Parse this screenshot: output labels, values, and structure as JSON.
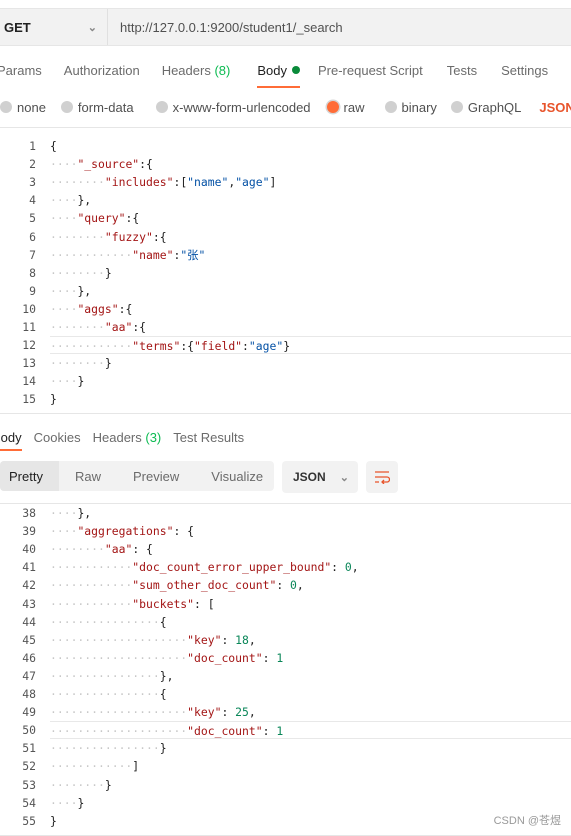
{
  "request": {
    "method": "GET",
    "url": "http://127.0.0.1:9200/student1/_search"
  },
  "tabs": [
    {
      "label": "Params"
    },
    {
      "label": "Authorization"
    },
    {
      "label": "Headers",
      "count": "(8)"
    },
    {
      "label": "Body"
    },
    {
      "label": "Pre-request Script"
    },
    {
      "label": "Tests"
    },
    {
      "label": "Settings"
    }
  ],
  "body_types": [
    {
      "label": "none",
      "selected": false
    },
    {
      "label": "form-data",
      "selected": false
    },
    {
      "label": "x-www-form-urlencoded",
      "selected": false
    },
    {
      "label": "raw",
      "selected": true
    },
    {
      "label": "binary",
      "selected": false
    },
    {
      "label": "GraphQL",
      "selected": false
    }
  ],
  "body_format": "JSON",
  "request_body": {
    "start": 1,
    "cursor_line": 12,
    "lines": [
      "{",
      "    \"_source\":{",
      "        \"includes\":[\"name\",\"age\"]",
      "    },",
      "    \"query\":{",
      "        \"fuzzy\":{",
      "            \"name\":\"张\"",
      "        }",
      "    },",
      "    \"aggs\":{",
      "        \"aa\":{",
      "            \"terms\":{\"field\":\"age\"}",
      "        }",
      "    }",
      "}"
    ]
  },
  "response_tabs": [
    {
      "label": "Body"
    },
    {
      "label": "Cookies"
    },
    {
      "label": "Headers",
      "count": "(3)"
    },
    {
      "label": "Test Results"
    }
  ],
  "view_modes": [
    "Pretty",
    "Raw",
    "Preview",
    "Visualize"
  ],
  "response_format": "JSON",
  "response_body": {
    "start": 38,
    "cursor_line": 50,
    "lines": [
      "    },",
      "    \"aggregations\": {",
      "        \"aa\": {",
      "            \"doc_count_error_upper_bound\": 0,",
      "            \"sum_other_doc_count\": 0,",
      "            \"buckets\": [",
      "                {",
      "                    \"key\": 18,",
      "                    \"doc_count\": 1",
      "                },",
      "                {",
      "                    \"key\": 25,",
      "                    \"doc_count\": 1",
      "                }",
      "            ]",
      "        }",
      "    }",
      "}"
    ]
  },
  "watermark": "CSDN @苍煜"
}
